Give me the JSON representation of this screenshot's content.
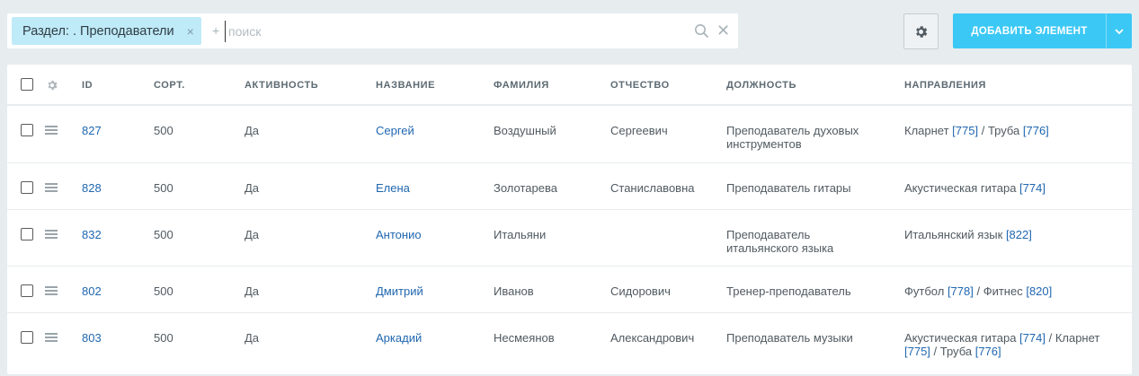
{
  "filter": {
    "chip_label": "Раздел: . Преподаватели",
    "chip_close": "×",
    "plus": "+",
    "search_placeholder": "поиск",
    "clear": "✕"
  },
  "toolbar": {
    "settings_icon": "gear-icon",
    "add_label": "ДОБАВИТЬ ЭЛЕМЕНТ",
    "add_arrow_icon": "chevron-down-icon"
  },
  "colors": {
    "accent": "#3bc8f5",
    "link": "#2067b0",
    "chip": "#bfeaf8",
    "background": "#e7ecef"
  },
  "table": {
    "columns": [
      "ID",
      "СОРТ.",
      "АКТИВНОСТЬ",
      "НАЗВАНИЕ",
      "ФАМИЛИЯ",
      "ОТЧЕСТВО",
      "ДОЛЖНОСТЬ",
      "НАПРАВЛЕНИЯ"
    ],
    "rows": [
      {
        "id": "827",
        "sort": "500",
        "active": "Да",
        "name": "Сергей",
        "surname": "Воздушный",
        "patronymic": "Сергеевич",
        "position": "Преподаватель духовых инструментов",
        "directions": [
          {
            "text": "Кларнет ",
            "ref": "[775]",
            "sep": " / "
          },
          {
            "text": "Труба ",
            "ref": "[776]",
            "sep": ""
          }
        ]
      },
      {
        "id": "828",
        "sort": "500",
        "active": "Да",
        "name": "Елена",
        "surname": "Золотарева",
        "patronymic": "Станиславовна",
        "position": "Преподаватель гитары",
        "directions": [
          {
            "text": "Акустическая гитара ",
            "ref": "[774]",
            "sep": ""
          }
        ]
      },
      {
        "id": "832",
        "sort": "500",
        "active": "Да",
        "name": "Антонио",
        "surname": "Итальяни",
        "patronymic": "",
        "position": "Преподаватель итальянского языка",
        "directions": [
          {
            "text": "Итальянский язык ",
            "ref": "[822]",
            "sep": ""
          }
        ]
      },
      {
        "id": "802",
        "sort": "500",
        "active": "Да",
        "name": "Дмитрий",
        "surname": "Иванов",
        "patronymic": "Сидорович",
        "position": "Тренер-преподаватель",
        "directions": [
          {
            "text": "Футбол ",
            "ref": "[778]",
            "sep": " / "
          },
          {
            "text": "Фитнес ",
            "ref": "[820]",
            "sep": ""
          }
        ]
      },
      {
        "id": "803",
        "sort": "500",
        "active": "Да",
        "name": "Аркадий",
        "surname": "Несмеянов",
        "patronymic": "Александрович",
        "position": "Преподаватель музыки",
        "directions": [
          {
            "text": "Акустическая гитара ",
            "ref": "[774]",
            "sep": " / "
          },
          {
            "text": "Кларнет ",
            "ref": "[775]",
            "sep": " / "
          },
          {
            "text": "Труба ",
            "ref": "[776]",
            "sep": ""
          }
        ]
      }
    ]
  }
}
